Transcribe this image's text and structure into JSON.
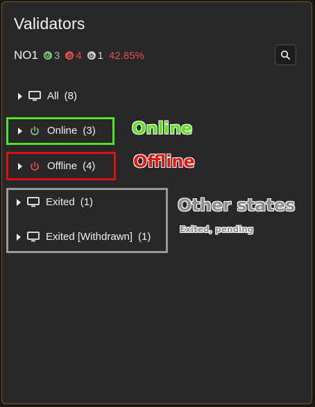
{
  "panel": {
    "title": "Validators"
  },
  "summary": {
    "node_name": "NO1",
    "online_count": "3",
    "offline_count": "4",
    "other_count": "1",
    "percent": "42.85%",
    "colors": {
      "online": "#7cc47e",
      "offline": "#e0504a",
      "other": "#cfcfcf"
    }
  },
  "search": {
    "icon": "search-icon"
  },
  "rows": [
    {
      "icon": "monitor-icon",
      "label": "All",
      "count": "(8)"
    },
    {
      "icon": "power-icon",
      "label": "Online",
      "count": "(3)"
    },
    {
      "icon": "power-icon",
      "label": "Offline",
      "count": "(4)"
    },
    {
      "icon": "monitor-icon",
      "label": "Exited",
      "count": "(1)"
    },
    {
      "icon": "monitor-icon",
      "label": "Exited [Withdrawn]",
      "count": "(1)"
    }
  ],
  "annotations": {
    "online": "Online",
    "offline": "Offline",
    "other": "Other states",
    "other_sub": "Exited, pending"
  }
}
